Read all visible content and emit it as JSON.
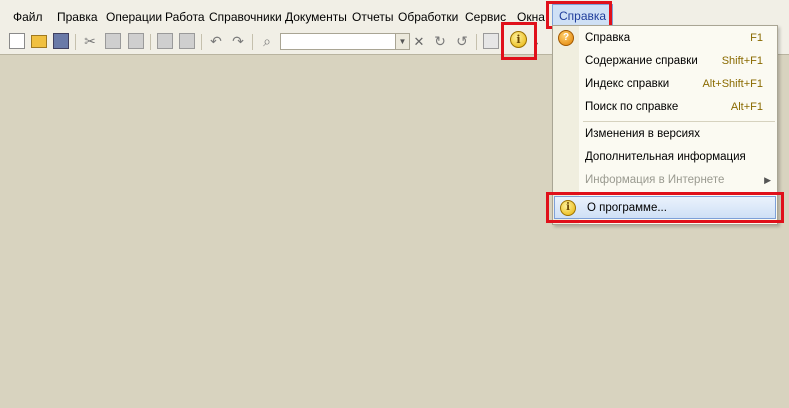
{
  "menubar": {
    "items": [
      {
        "label": "Файл"
      },
      {
        "label": "Правка"
      },
      {
        "label": "Операции"
      },
      {
        "label": "Работа"
      },
      {
        "label": "Справочники"
      },
      {
        "label": "Документы"
      },
      {
        "label": "Отчеты"
      },
      {
        "label": "Обработки"
      },
      {
        "label": "Сервис"
      },
      {
        "label": "Окна"
      },
      {
        "label": "Справка"
      }
    ]
  },
  "toolbar": {
    "icons": [
      "new-document-icon",
      "open-folder-icon",
      "save-icon",
      "cut-icon",
      "copy-icon",
      "paste-icon",
      "print-icon",
      "print-preview-icon",
      "undo-icon",
      "redo-icon",
      "search-icon",
      "find-next-icon",
      "find-previous-icon",
      "windows-icon",
      "info-icon"
    ],
    "search": {
      "value": "",
      "placeholder": ""
    }
  },
  "help_menu": {
    "items": [
      {
        "label": "Справка",
        "shortcut": "F1"
      },
      {
        "label": "Содержание справки",
        "shortcut": "Shift+F1"
      },
      {
        "label": "Индекс справки",
        "shortcut": "Alt+Shift+F1"
      },
      {
        "label": "Поиск по справке",
        "shortcut": "Alt+F1"
      },
      {
        "label": "Изменения в версиях",
        "shortcut": ""
      },
      {
        "label": "Дополнительная информация",
        "shortcut": ""
      },
      {
        "label": "Информация в Интернете",
        "shortcut": ""
      },
      {
        "label": "О программе...",
        "shortcut": ""
      }
    ]
  },
  "colors": {
    "highlight": "#e0101a",
    "background": "#d8d3bf",
    "menu_active": "#cfe0f5"
  }
}
